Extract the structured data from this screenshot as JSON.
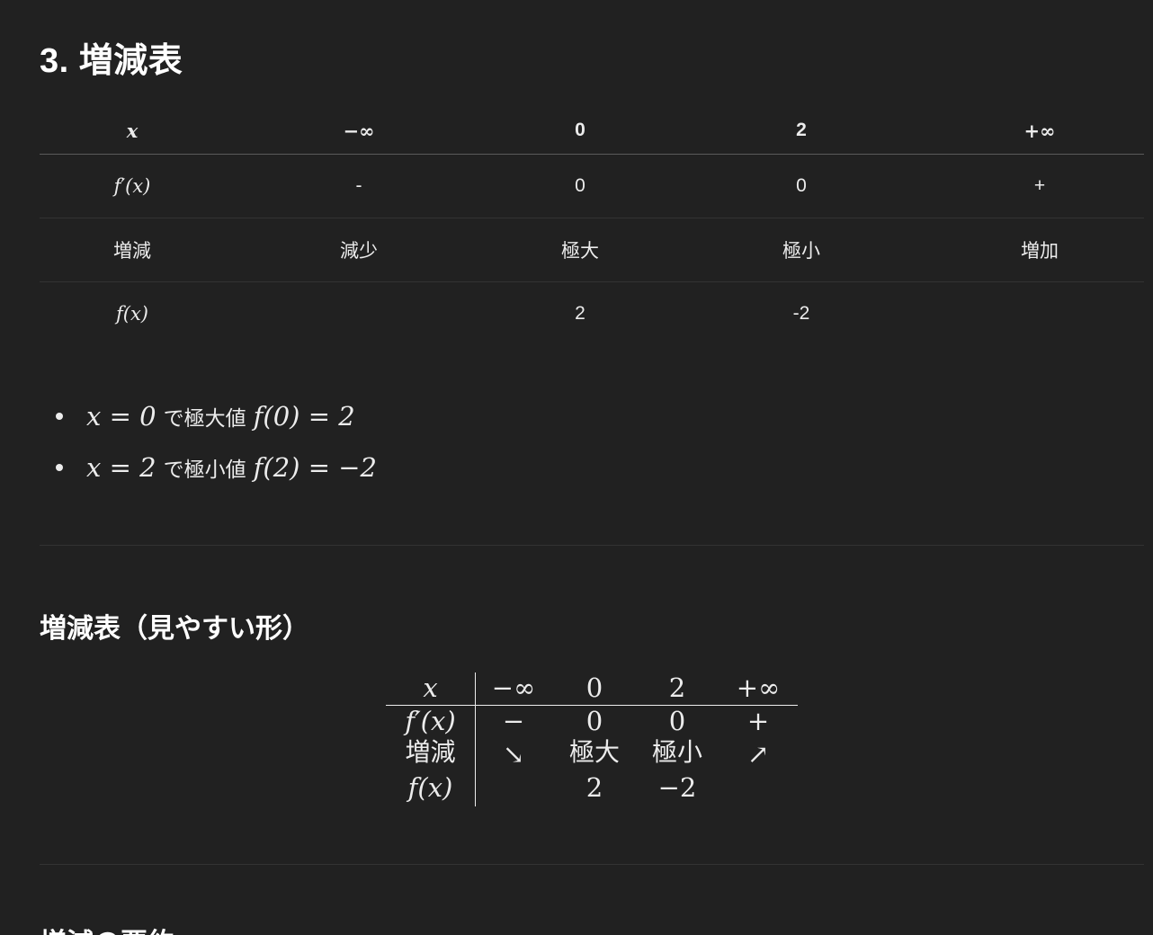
{
  "section_title": "3. 増減表",
  "table": {
    "header": [
      "x",
      "−∞",
      "0",
      "2",
      "+∞"
    ],
    "rows": [
      [
        "f′(x)",
        "-",
        "0",
        "0",
        "+"
      ],
      [
        "増減",
        "減少",
        "極大",
        "極小",
        "増加"
      ],
      [
        "f(x)",
        "",
        "2",
        "-2",
        ""
      ]
    ]
  },
  "bullets": [
    {
      "lhs": "x = 0",
      "jp": "で極大値",
      "rhs": "f(0) = 2"
    },
    {
      "lhs": "x = 2",
      "jp": "で極小値",
      "rhs": "f(2) = −2"
    }
  ],
  "subsection_title": "増減表（見やすい形）",
  "array": {
    "row_labels": [
      "x",
      "f′(x)",
      "増減",
      "f(x)"
    ],
    "header": [
      "−∞",
      "0",
      "2",
      "+∞"
    ],
    "rows": [
      [
        "−",
        "0",
        "0",
        "+"
      ],
      [
        "↘",
        "極大",
        "極小",
        "↗"
      ],
      [
        "",
        "2",
        "−2",
        ""
      ]
    ]
  },
  "next_title": "増減の要約"
}
